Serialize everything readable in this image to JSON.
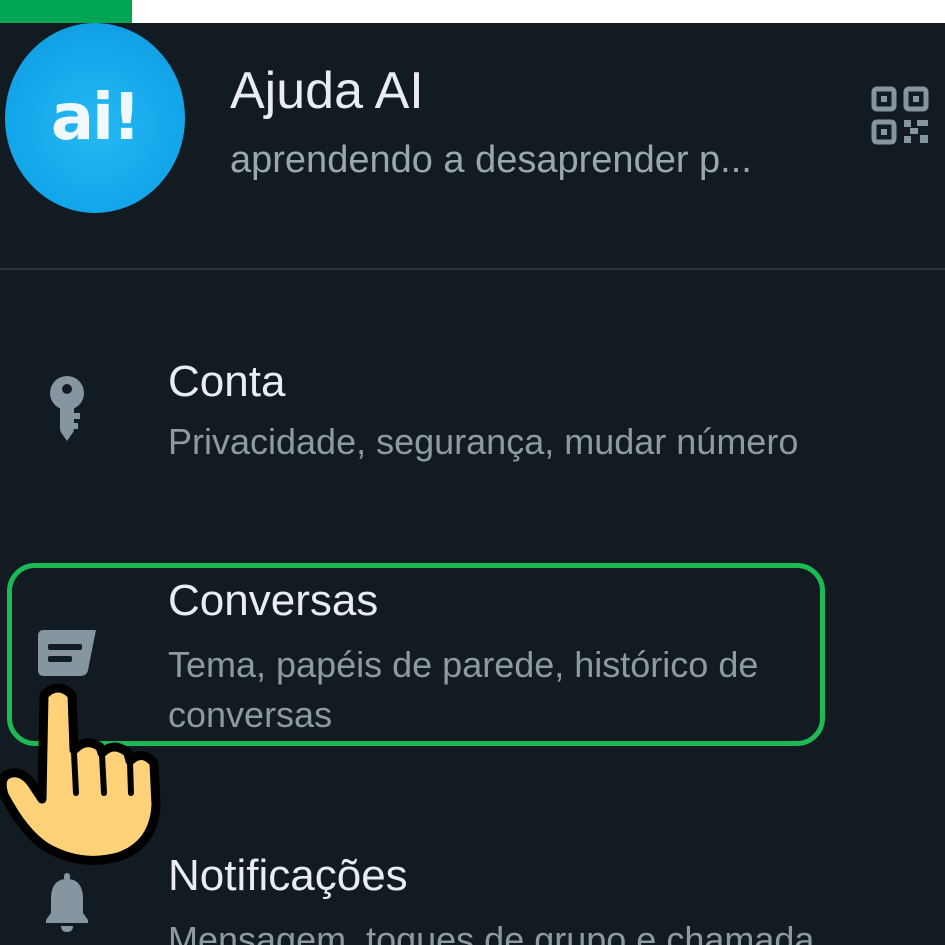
{
  "top_strip": {
    "progress": 0.14,
    "progress_color": "#00a651"
  },
  "profile": {
    "avatar_logo": "ai!",
    "name": "Ajuda AI",
    "status": "aprendendo a desaprender p...",
    "qr_icon": "qr-code-icon"
  },
  "settings": {
    "account": {
      "icon": "key-icon",
      "title": "Conta",
      "subtitle": "Privacidade, segurança, mudar número"
    },
    "chats": {
      "icon": "chat-icon",
      "title": "Conversas",
      "subtitle": "Tema, papéis de parede, histórico de conversas"
    },
    "notifications": {
      "icon": "bell-icon",
      "title": "Notificações",
      "subtitle": "Mensagem, toques de grupo e chamada"
    }
  },
  "highlight": {
    "color": "#1db954"
  },
  "colors": {
    "background": "#121b22",
    "title_text": "#e9edef",
    "subtitle_text": "#8e9aa1",
    "icon": "#8696a0"
  }
}
